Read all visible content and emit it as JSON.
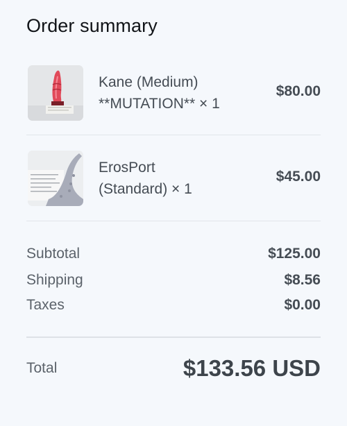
{
  "title": "Order summary",
  "items": [
    {
      "name_line1": "Kane (Medium)",
      "name_line2": "**MUTATION** × 1",
      "price": "$80.00"
    },
    {
      "name_line1": "ErosPort",
      "name_line2": "(Standard) × 1",
      "price": "$45.00"
    }
  ],
  "summary": {
    "subtotal_label": "Subtotal",
    "subtotal_value": "$125.00",
    "shipping_label": "Shipping",
    "shipping_value": "$8.56",
    "taxes_label": "Taxes",
    "taxes_value": "$0.00",
    "total_label": "Total",
    "total_value": "$133.56 USD"
  }
}
